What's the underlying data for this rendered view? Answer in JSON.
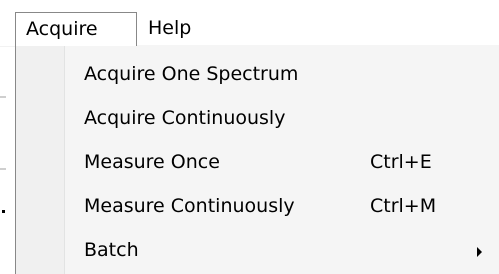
{
  "menubar": {
    "items": [
      {
        "label": "Acquire"
      },
      {
        "label": "Help"
      }
    ]
  },
  "acquire_menu": {
    "items": [
      {
        "label": "Acquire One Spectrum",
        "shortcut": ""
      },
      {
        "label": "Acquire Continuously",
        "shortcut": ""
      },
      {
        "label": "Measure Once",
        "shortcut": "Ctrl+E"
      },
      {
        "label": "Measure Continuously",
        "shortcut": "Ctrl+M"
      },
      {
        "label": "Batch",
        "shortcut": "",
        "submenu_icon": "submenu-arrow-icon"
      }
    ]
  }
}
